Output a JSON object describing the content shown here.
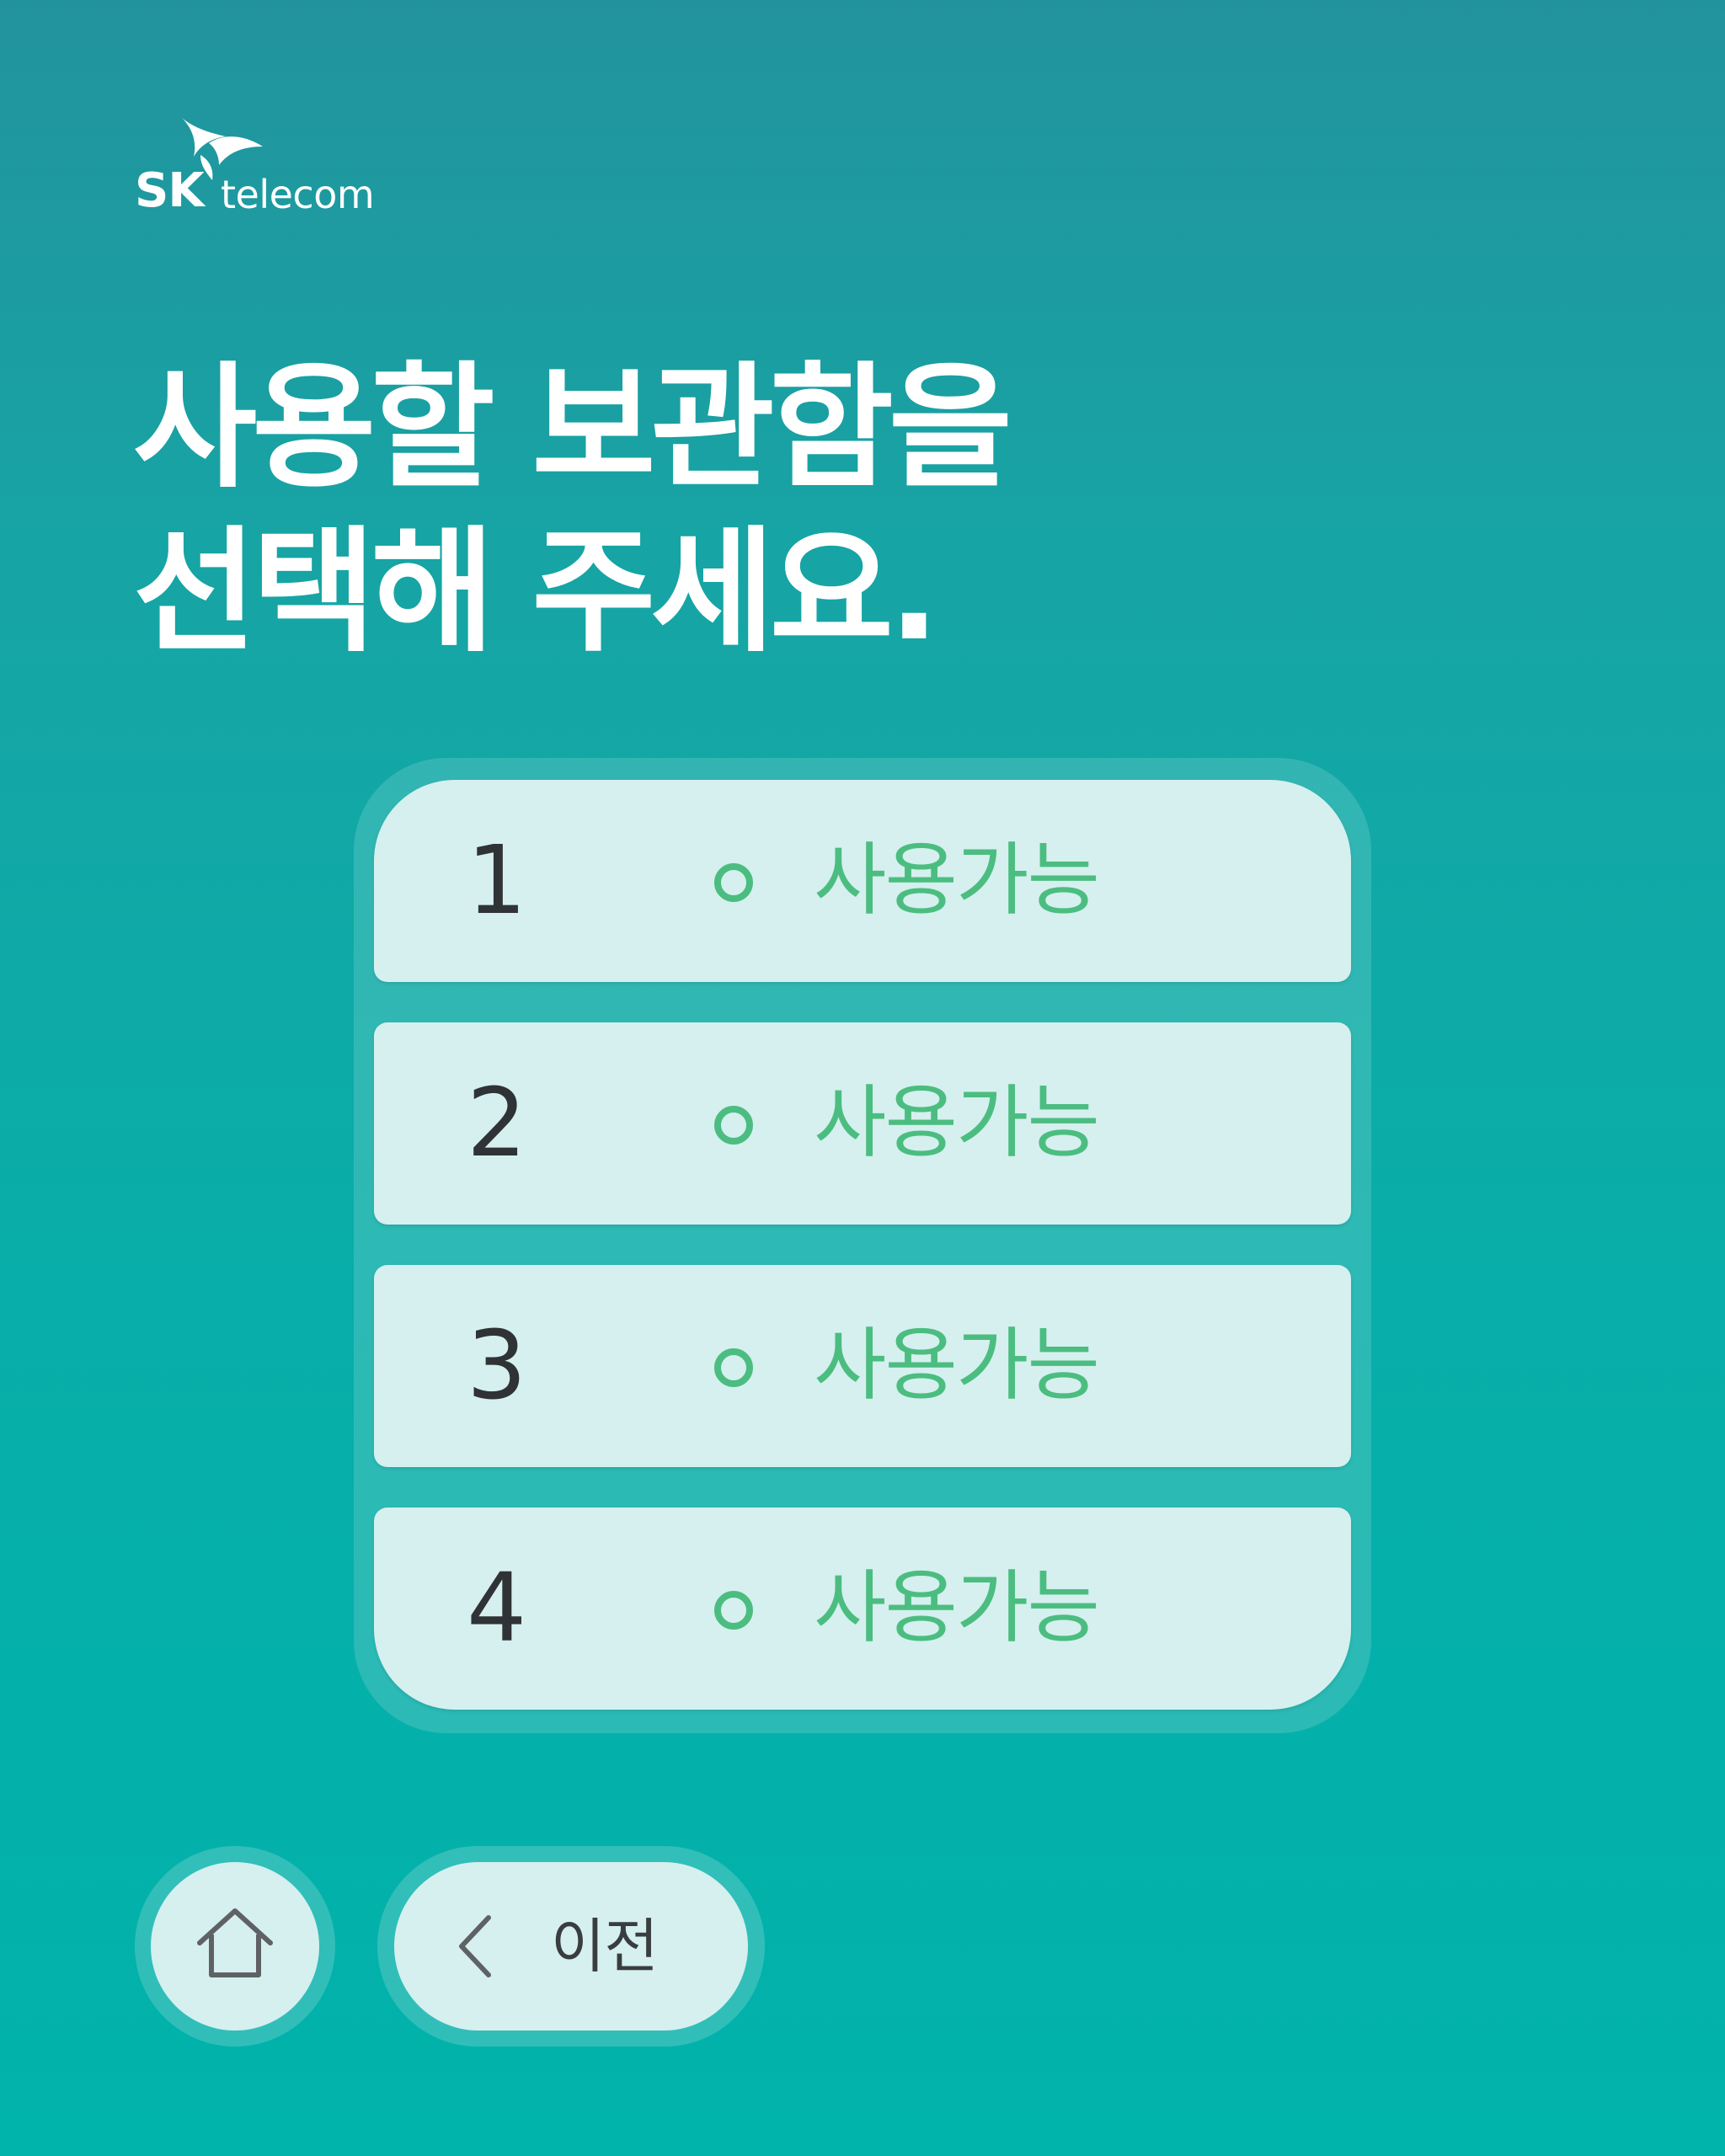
{
  "brand": {
    "logo_sk": "SK",
    "logo_text": "telecom",
    "mark_icon": "sk-butterfly-icon"
  },
  "title": {
    "line1": "사용할 보관함을",
    "line2": "선택해 주세요."
  },
  "lockers": [
    {
      "number": "1",
      "status": "사용가능"
    },
    {
      "number": "2",
      "status": "사용가능"
    },
    {
      "number": "3",
      "status": "사용가능"
    },
    {
      "number": "4",
      "status": "사용가능"
    }
  ],
  "nav": {
    "home_icon": "home-icon",
    "back_icon": "chevron-left-icon",
    "back_label": "이전"
  },
  "colors": {
    "background_top": "#22939d",
    "background_bottom": "#00b3ab",
    "card": "#d5f0ef",
    "available": "#4cbd80",
    "number_text": "#2f3335"
  }
}
